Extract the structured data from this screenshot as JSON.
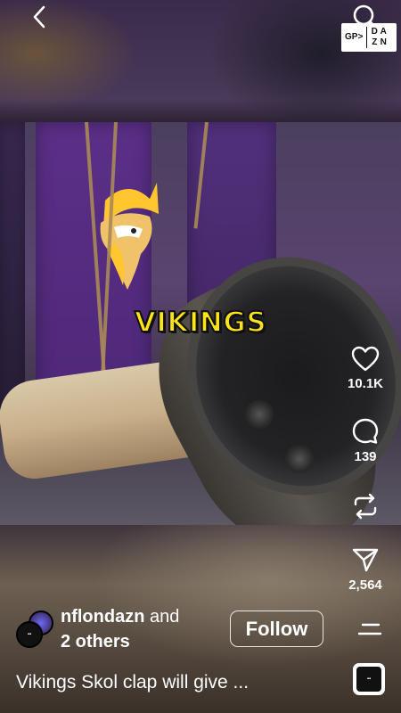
{
  "video": {
    "overlay_caption": "VIKINGS",
    "logo": {
      "nfl": "GP>",
      "dazn": [
        "D",
        "A",
        "Z",
        "N"
      ]
    }
  },
  "actions": {
    "like_count": "10.1K",
    "comment_count": "139",
    "share_count": "2,564"
  },
  "post": {
    "username": "nflondazn",
    "coauthor_joiner": "and",
    "coauthor_others": "2 others",
    "follow_label": "Follow",
    "caption": "Vikings Skol clap will give ..."
  },
  "colors": {
    "caption_yellow": "#ffe515",
    "vikings_purple": "#4e2878"
  }
}
